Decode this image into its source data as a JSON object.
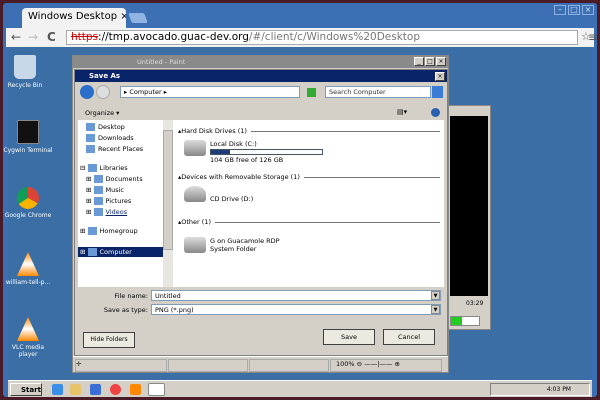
{
  "browser": {
    "tab_title": "Windows Desktop",
    "tab_close": "×",
    "url_scheme": "https",
    "url_host": "://tmp.avocado.guac-dev.org",
    "url_path": "/#/client/c/Windows%20Desktop",
    "back": "←",
    "forward": "→",
    "reload": "C",
    "star": "☆",
    "menu": "≡"
  },
  "desktop_icons": [
    {
      "label": "Recycle Bin",
      "icon": "recycle-bin-icon"
    },
    {
      "label": "Cygwin Terminal",
      "icon": "terminal-icon"
    },
    {
      "label": "Google Chrome",
      "icon": "chrome-icon"
    },
    {
      "label": "william-tell-p...",
      "icon": "vlc-icon"
    },
    {
      "label": "VLC media player",
      "icon": "vlc-icon"
    }
  ],
  "paint": {
    "title": "Untitled - Paint",
    "zoom": "100%",
    "zoom_level_percent": 100
  },
  "dialog": {
    "title": "Save As",
    "breadcrumb": "▸ Computer ▸",
    "search_placeholder": "Search Computer",
    "organize": "Organize ▾",
    "nav": [
      {
        "label": "Desktop",
        "indent": 1
      },
      {
        "label": "Downloads",
        "indent": 1
      },
      {
        "label": "Recent Places",
        "indent": 1
      },
      {
        "label": "Libraries",
        "indent": 0,
        "exp": "⊟"
      },
      {
        "label": "Documents",
        "indent": 1,
        "exp": "⊞"
      },
      {
        "label": "Music",
        "indent": 1,
        "exp": "⊞"
      },
      {
        "label": "Pictures",
        "indent": 1,
        "exp": "⊞"
      },
      {
        "label": "Videos",
        "indent": 1,
        "exp": "⊞"
      },
      {
        "label": "Homegroup",
        "indent": 0,
        "exp": "⊞"
      },
      {
        "label": "Computer",
        "indent": 0,
        "exp": "⊞",
        "selected": true
      }
    ],
    "groups": [
      {
        "header": "Hard Disk Drives (1)",
        "items": [
          {
            "name": "Local Disk (C:)",
            "detail": "104 GB free of 126 GB",
            "used_fraction": 0.175
          }
        ]
      },
      {
        "header": "Devices with Removable Storage (1)",
        "items": [
          {
            "name": "CD Drive (D:)"
          }
        ]
      },
      {
        "header": "Other (1)",
        "items": [
          {
            "name": "G on Guacamole RDP",
            "detail": "System Folder"
          }
        ]
      }
    ],
    "file_name_label": "File name:",
    "file_name": "Untitled",
    "type_label": "Save as type:",
    "type_value": "PNG (*.png)",
    "hide_folders": "Hide Folders",
    "save": "Save",
    "cancel": "Cancel"
  },
  "media": {
    "time": "03:29"
  },
  "taskbar": {
    "start": "Start",
    "clock": "4:03 PM"
  },
  "colors": {
    "desktop": "#3a6ea5",
    "chrome_frame": "#3c6fb3",
    "dialog_title": "#0a246a",
    "selection": "#0a246a"
  }
}
